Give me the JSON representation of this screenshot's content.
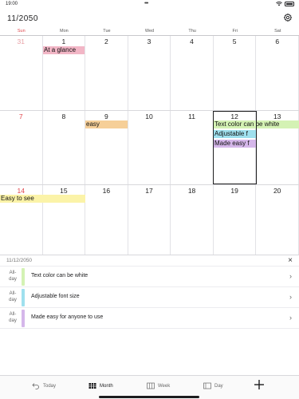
{
  "status_bar": {
    "time": "19:00",
    "dots": "•••"
  },
  "header": {
    "month_title": "11/2050"
  },
  "weekdays": [
    "Sun",
    "Mon",
    "Tue",
    "Wed",
    "Thu",
    "Fri",
    "Sat"
  ],
  "weeks": [
    {
      "days": [
        "31",
        "1",
        "2",
        "3",
        "4",
        "5",
        "6"
      ]
    },
    {
      "days": [
        "7",
        "8",
        "9",
        "10",
        "11",
        "12",
        "13"
      ]
    },
    {
      "days": [
        "14",
        "15",
        "16",
        "17",
        "18",
        "19",
        "20"
      ]
    }
  ],
  "events": [
    {
      "label": "At a glance",
      "color": "#f2b6c6"
    },
    {
      "label": "easy",
      "color": "#f6cf98"
    },
    {
      "label": "Text color can be white",
      "color": "#d4f2b4"
    },
    {
      "label": "Adjustable f",
      "color": "#9fe0ee"
    },
    {
      "label": "Made easy f",
      "color": "#d5b7ea"
    },
    {
      "label": "Easy to see",
      "color": "#fbf3a8"
    }
  ],
  "detail": {
    "date": "11/12/2050",
    "close": "×",
    "rows": [
      {
        "allday": "All-day",
        "title": "Text color can be white",
        "color": "#d4f2b4"
      },
      {
        "allday": "All-day",
        "title": "Adjustable font size",
        "color": "#9fe0ee"
      },
      {
        "allday": "All-day",
        "title": "Made easy for anyone to use",
        "color": "#d5b7ea"
      }
    ]
  },
  "tabs": {
    "today": "Today",
    "month": "Month",
    "week": "Week",
    "day": "Day"
  },
  "colors": {
    "sunday": "#e0464c",
    "previous_month": "#e8a0a6"
  }
}
